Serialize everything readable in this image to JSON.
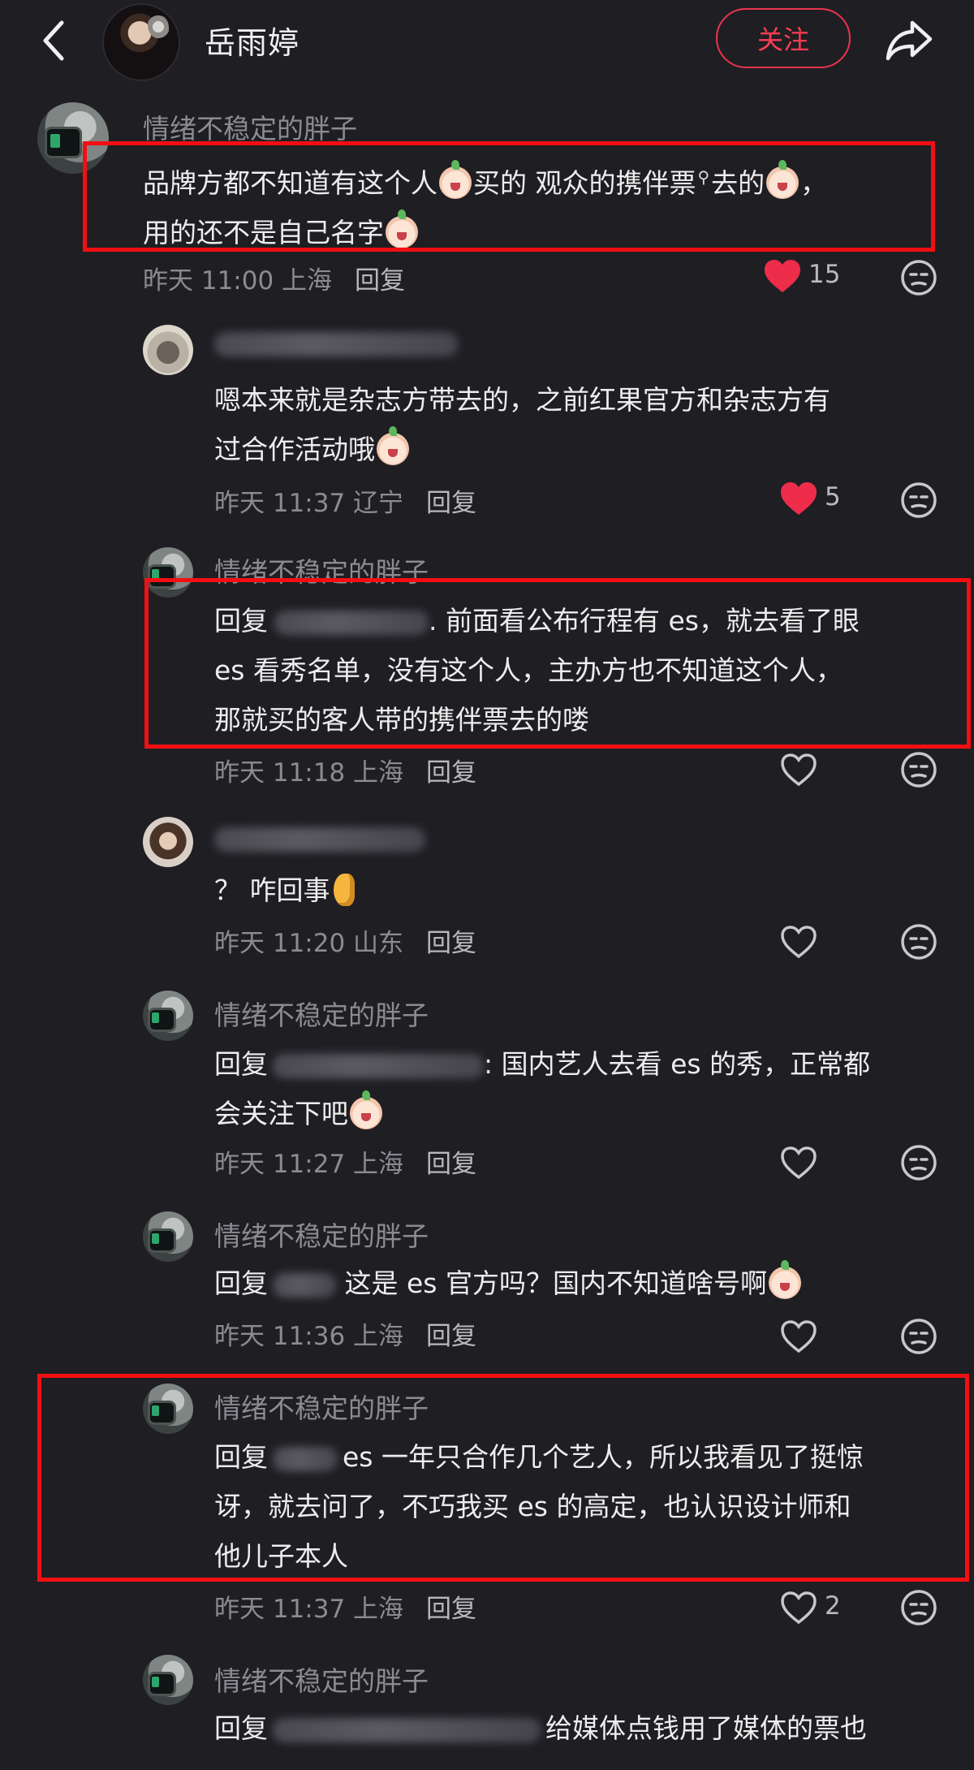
{
  "header": {
    "back_icon": "chevron-left-icon",
    "username": "岳雨婷",
    "follow_label": "关注",
    "share_icon": "share-arrow-icon"
  },
  "colors": {
    "background": "#1f1e23",
    "accent": "#ff3d55",
    "like_active": "#ee2d4a",
    "highlight_box": "#f20f12"
  },
  "comments": [
    {
      "username": "情绪不稳定的胖子",
      "lines": [
        "品牌方都不知道有这个人",
        "买的 观众的携伴票",
        "去的",
        "，",
        "用的还不是自己名字"
      ],
      "time": "昨天 11:00 上海",
      "reply_label": "回复",
      "likes": "15",
      "liked": true
    },
    {
      "username": "",
      "lines": [
        "嗯本来就是杂志方带去的，之前红果官方和杂志方有",
        "过合作活动哦"
      ],
      "time": "昨天 11:37 辽宁",
      "reply_label": "回复",
      "likes": "5",
      "liked": true
    },
    {
      "username": "情绪不稳定的胖子",
      "reply_prefix": "回复",
      "lines": [
        ". 前面看公布行程有 es，就去看了眼",
        "es 看秀名单，没有这个人，主办方也不知道这个人，",
        "那就买的客人带的携伴票去的喽"
      ],
      "time": "昨天 11:18 上海",
      "reply_label": "回复",
      "likes": "",
      "liked": false
    },
    {
      "username": "",
      "lines": [
        "？ 咋回事"
      ],
      "time": "昨天 11:20 山东",
      "reply_label": "回复",
      "likes": "",
      "liked": false
    },
    {
      "username": "情绪不稳定的胖子",
      "reply_prefix": "回复",
      "lines": [
        ": 国内艺人去看 es 的秀，正常都",
        "会关注下吧"
      ],
      "time": "昨天 11:27 上海",
      "reply_label": "回复",
      "likes": "",
      "liked": false
    },
    {
      "username": "情绪不稳定的胖子",
      "reply_prefix": "回复",
      "lines": [
        " 这是 es 官方吗？国内不知道啥号啊"
      ],
      "time": "昨天 11:36 上海",
      "reply_label": "回复",
      "likes": "",
      "liked": false
    },
    {
      "username": "情绪不稳定的胖子",
      "reply_prefix": "回复",
      "lines": [
        "es 一年只合作几个艺人，所以我看见了挺惊",
        "讶，就去问了，不巧我买 es 的高定，也认识设计师和",
        "他儿子本人"
      ],
      "time": "昨天 11:37 上海",
      "reply_label": "回复",
      "likes": "2",
      "liked": false
    },
    {
      "username": "情绪不稳定的胖子",
      "reply_prefix": "回复",
      "lines": [
        "给媒体点钱用了媒体的票也"
      ],
      "time": "",
      "reply_label": "",
      "likes": "",
      "liked": false
    }
  ]
}
